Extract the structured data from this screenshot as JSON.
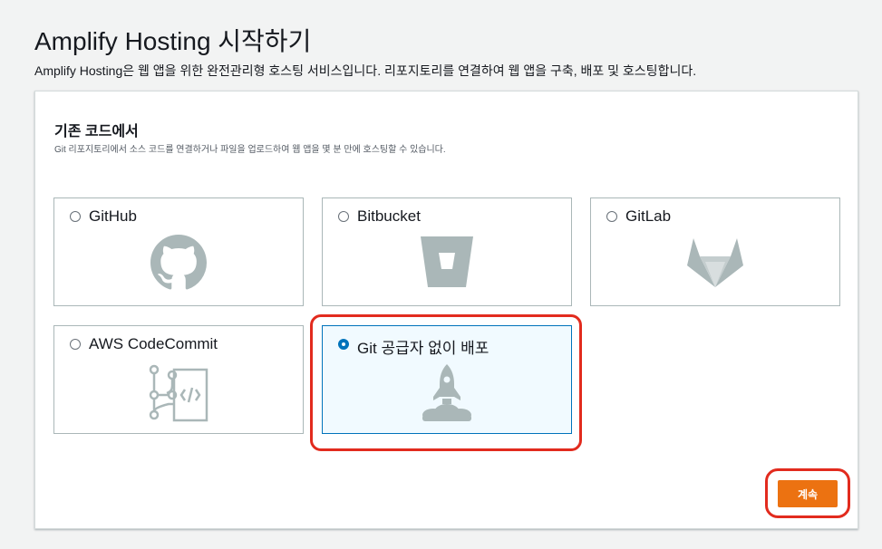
{
  "page": {
    "title": "Amplify Hosting 시작하기",
    "description": "Amplify Hosting은 웹 앱을 위한 완전관리형 호스팅 서비스입니다. 리포지토리를 연결하여 웹 앱을 구축, 배포 및 호스팅합니다."
  },
  "section": {
    "title": "기존 코드에서",
    "description": "Git 리포지토리에서 소스 코드를 연결하거나 파일을 업로드하여 웹 앱을 몇 분 만에 호스팅할 수 있습니다."
  },
  "options": [
    {
      "label": "GitHub",
      "icon": "github-icon",
      "selected": false
    },
    {
      "label": "Bitbucket",
      "icon": "bitbucket-icon",
      "selected": false
    },
    {
      "label": "GitLab",
      "icon": "gitlab-icon",
      "selected": false
    },
    {
      "label": "AWS CodeCommit",
      "icon": "codecommit-icon",
      "selected": false
    },
    {
      "label": "Git 공급자 없이 배포",
      "icon": "rocket-icon",
      "selected": true
    }
  ],
  "actions": {
    "continue_label": "계속"
  },
  "colors": {
    "accent": "#0073bb",
    "primary_button": "#ec7211",
    "icon_gray": "#aab7b8",
    "highlight": "#e22b1e"
  }
}
